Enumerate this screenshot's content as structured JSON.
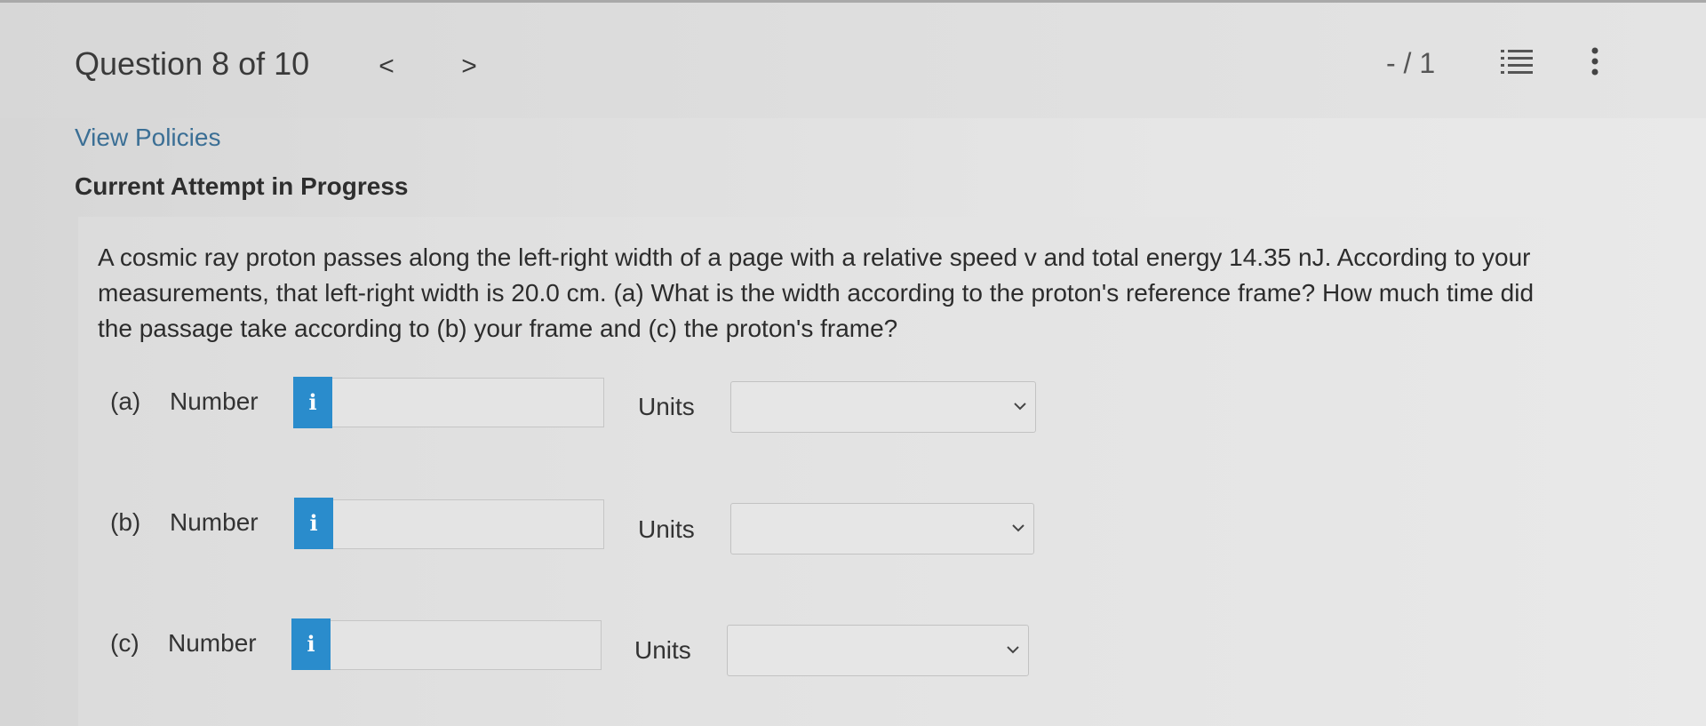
{
  "header": {
    "question_title": "Question 8 of 10",
    "prev_label": "<",
    "next_label": ">",
    "score": "- / 1"
  },
  "policies_link": "View Policies",
  "attempt_heading": "Current Attempt in Progress",
  "question": {
    "line1": "A cosmic ray proton passes along the left-right width of a page with a relative speed v and total energy 14.35 nJ. According to your",
    "line2": "measurements, that left-right width is 20.0 cm. (a) What is the width according to the proton's reference frame? How much time did",
    "line3": "the passage take according to (b) your frame and (c) the proton's frame?"
  },
  "parts": [
    {
      "label": "(a)",
      "number_label": "Number",
      "info": "i",
      "value": "",
      "units_label": "Units",
      "units_value": ""
    },
    {
      "label": "(b)",
      "number_label": "Number",
      "info": "i",
      "value": "",
      "units_label": "Units",
      "units_value": ""
    },
    {
      "label": "(c)",
      "number_label": "Number",
      "info": "i",
      "value": "",
      "units_label": "Units",
      "units_value": ""
    }
  ],
  "colors": {
    "link": "#3b6f95",
    "info_button": "#2a8ccc"
  },
  "icons": {
    "list": "list-icon",
    "more": "more-vertical-icon",
    "dropdown": "chevron-down-icon"
  }
}
